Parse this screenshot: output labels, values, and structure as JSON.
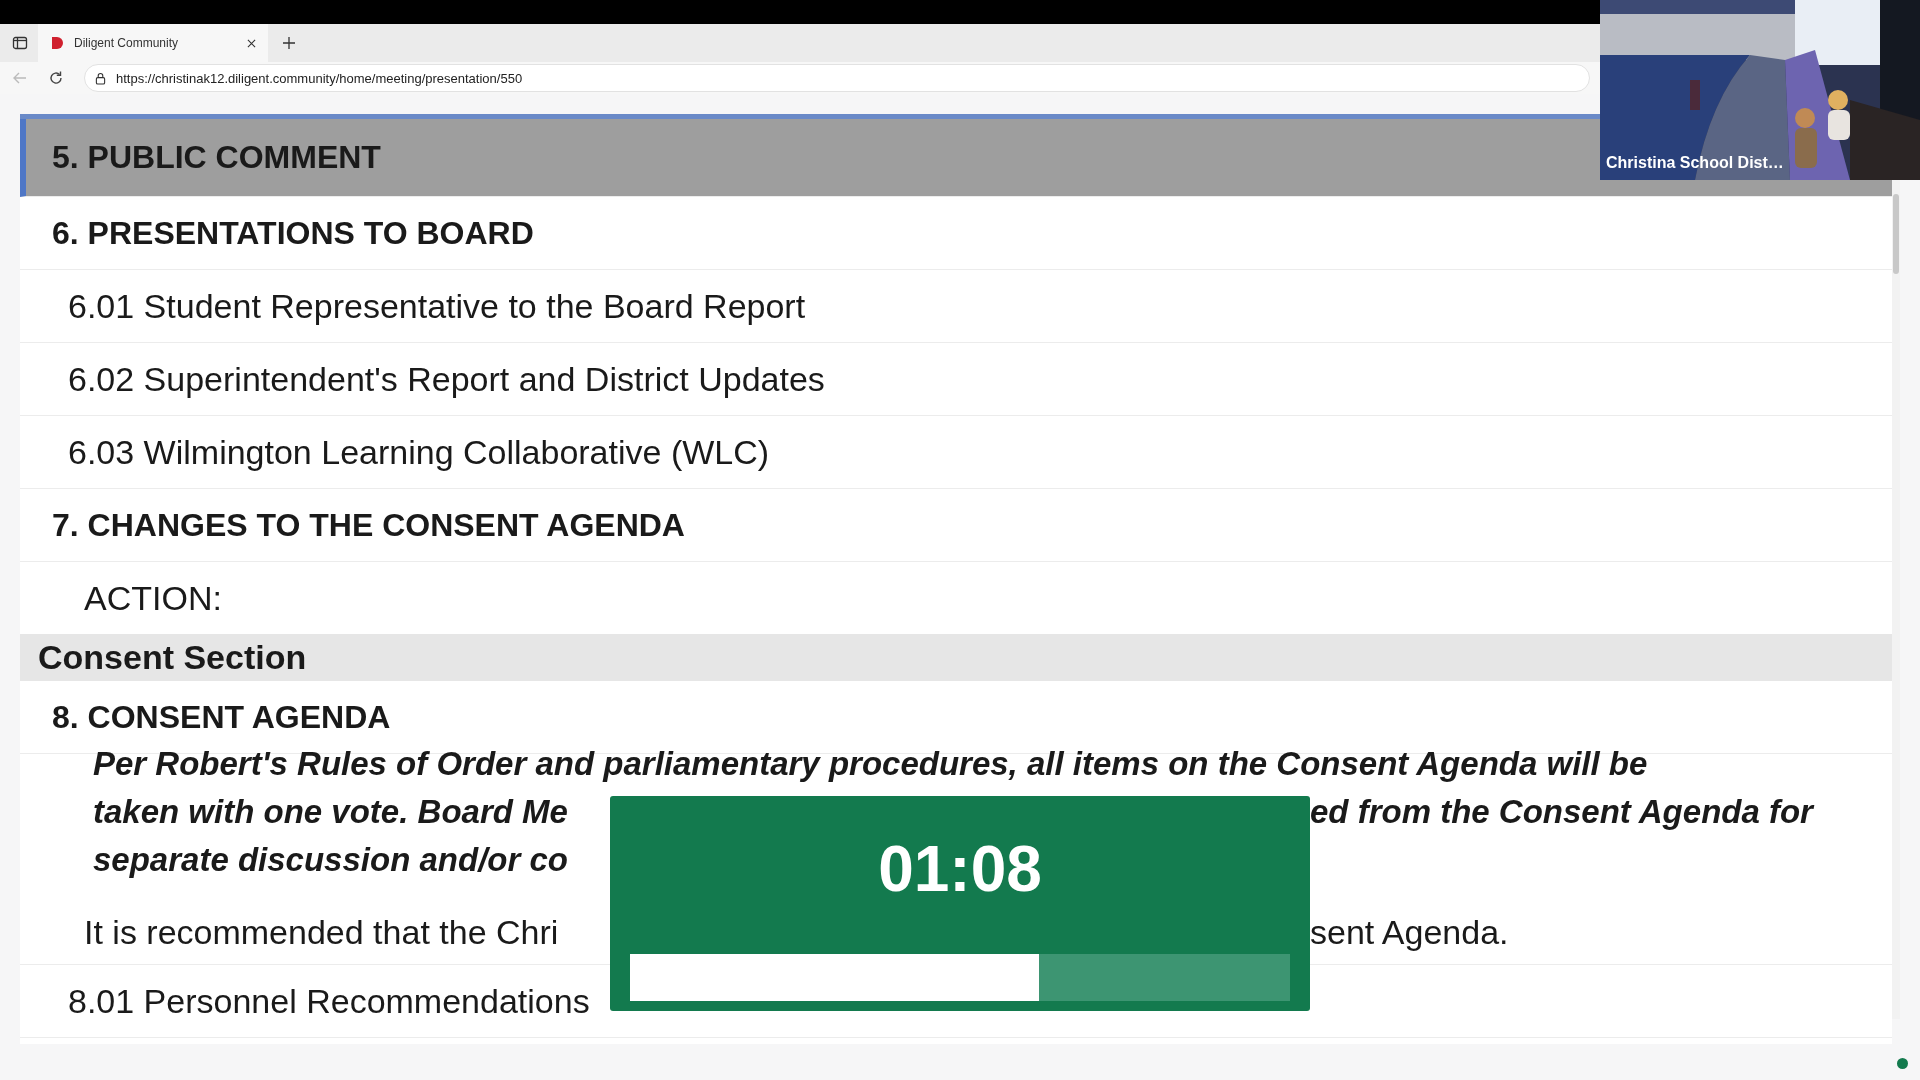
{
  "browser": {
    "tabs": [
      {
        "title": "Diligent Community",
        "selected": true
      }
    ],
    "url": "https://christinak12.diligent.community/home/meeting/presentation/550"
  },
  "agenda": [
    {
      "kind": "heading",
      "text": "5. PUBLIC COMMENT",
      "selected": true
    },
    {
      "kind": "heading",
      "text": "6. PRESENTATIONS TO BOARD",
      "selected": false
    },
    {
      "kind": "item",
      "text": "6.01 Student Representative to the Board Report",
      "selected": false
    },
    {
      "kind": "item",
      "text": "6.02 Superintendent's Report and District Updates",
      "selected": false
    },
    {
      "kind": "item",
      "text": "6.03 Wilmington Learning Collaborative (WLC)",
      "selected": false
    },
    {
      "kind": "heading",
      "text": "7. CHANGES TO THE CONSENT AGENDA",
      "selected": false
    },
    {
      "kind": "label",
      "text": "ACTION:",
      "selected": false
    },
    {
      "kind": "band",
      "text": "Consent Section",
      "selected": false
    },
    {
      "kind": "heading",
      "text": "8. CONSENT AGENDA",
      "selected": false
    },
    {
      "kind": "emphasis",
      "selected": false,
      "lines": [
        {
          "left": "Per Robert's Rules of Order and parliamentary procedures, all items on the Consent Agenda will be"
        },
        {
          "left": "taken with one vote. Board Me",
          "right": "ed from the Consent Agenda for"
        },
        {
          "left": "separate discussion and/or co"
        }
      ]
    },
    {
      "kind": "text",
      "selected": false,
      "lines": [
        {
          "left": "It is recommended that the Chri",
          "right": "sent Agenda."
        }
      ]
    },
    {
      "kind": "item",
      "text": "8.01 Personnel Recommendations",
      "selected": false
    }
  ],
  "timer": {
    "time": "01:08",
    "level": 0.62
  },
  "video": {
    "caption": "Christina School Dist…"
  }
}
